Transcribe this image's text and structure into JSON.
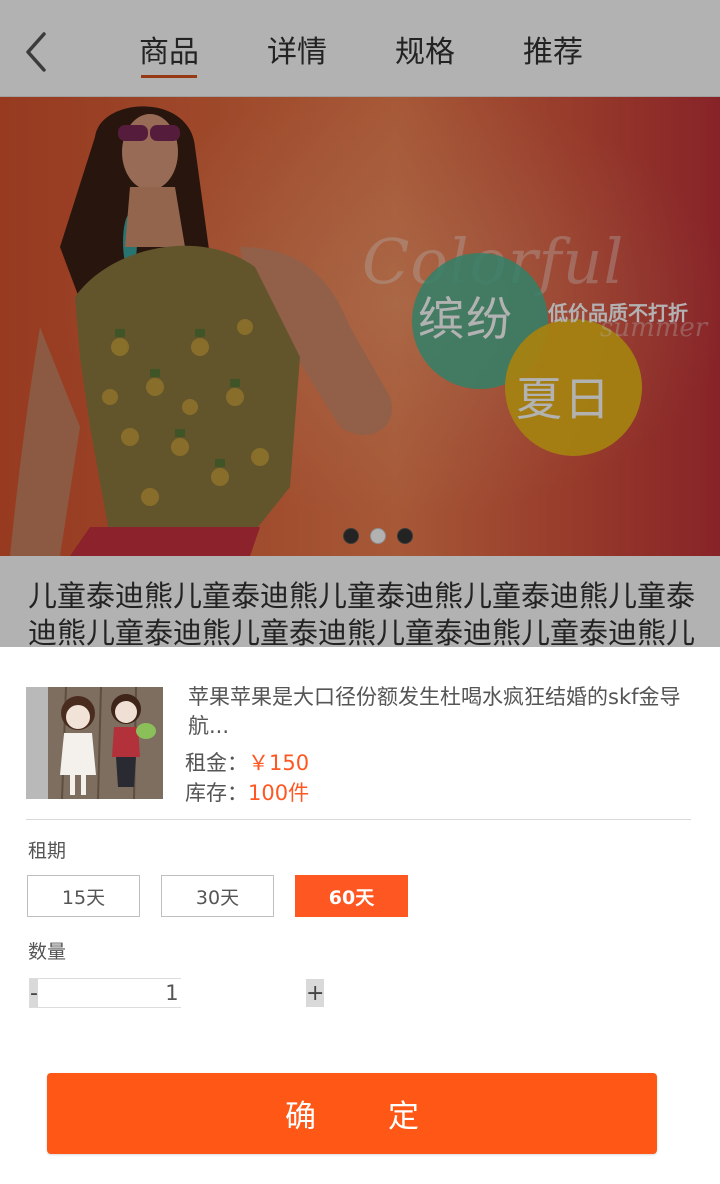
{
  "header": {
    "back_icon": "chevron-left-icon",
    "tabs": [
      {
        "label": "商品",
        "active": true
      },
      {
        "label": "详情",
        "active": false
      },
      {
        "label": "规格",
        "active": false
      },
      {
        "label": "推荐",
        "active": false
      }
    ]
  },
  "banner": {
    "title_en": "Colorful",
    "subtitle_en": "summer",
    "title_cn_1": "缤纷",
    "title_cn_2": "夏日",
    "tagline": "低价品质不打折",
    "slides_total": 3,
    "slide_active": 2
  },
  "product": {
    "title": "儿童泰迪熊儿童泰迪熊儿童泰迪熊儿童泰迪熊儿童泰迪熊儿童泰迪熊儿童泰迪熊儿童泰迪熊儿童泰迪熊儿"
  },
  "sheet": {
    "item_name": "苹果苹果是大口径份额发生杜喝水疯狂结婚的skf金导航...",
    "price_label": "租金：",
    "price_value": "￥150",
    "stock_label": "库存：",
    "stock_value": "100件",
    "period_label": "租期",
    "periods": [
      "15天",
      "30天",
      "60天"
    ],
    "selected_period": "60天",
    "quantity_label": "数量",
    "quantity_value": "1",
    "minus_label": "-",
    "plus_label": "+",
    "confirm_label": "确定"
  },
  "colors": {
    "accent": "#ff5722",
    "confirm": "#ff5715",
    "tab_underline": "#d9531e",
    "overlay": "rgba(0,0,0,0.30)"
  }
}
